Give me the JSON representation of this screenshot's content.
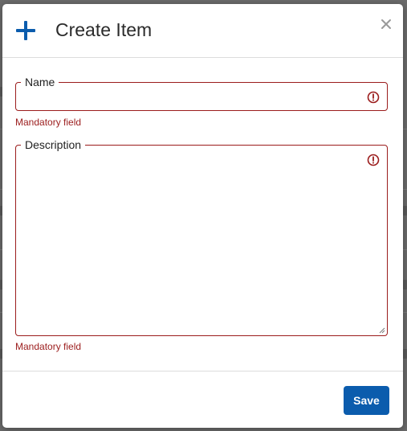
{
  "modal": {
    "title": "Create Item",
    "header_icon": "plus-icon",
    "close_icon": "close-icon",
    "close_symbol": "×"
  },
  "form": {
    "name": {
      "label": "Name",
      "value": "",
      "error_icon": "alert-circle-icon",
      "helper": "Mandatory field"
    },
    "description": {
      "label": "Description",
      "value": "",
      "error_icon": "alert-circle-icon",
      "helper": "Mandatory field"
    }
  },
  "footer": {
    "save_label": "Save"
  },
  "colors": {
    "accent": "#0b5cad",
    "error": "#9b1c1c",
    "overlay": "#6b6b6b"
  }
}
